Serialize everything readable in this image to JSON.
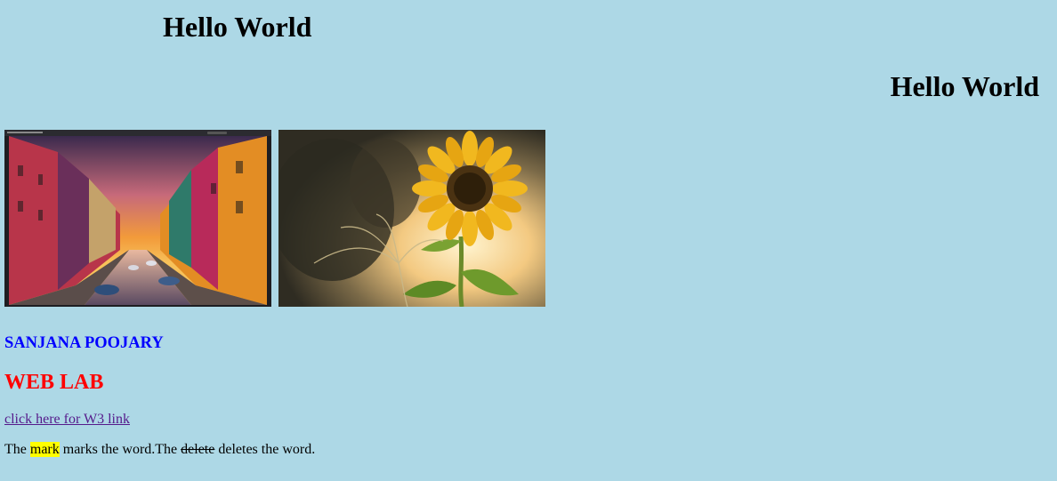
{
  "headings": {
    "center": "Hello World",
    "right": "Hello World"
  },
  "images": {
    "canal": {
      "alt": "Colorful canal houses at sunset",
      "icon": "photo-canal"
    },
    "sunflower": {
      "alt": "Sunflower at sunset",
      "icon": "photo-sunflower"
    }
  },
  "name_heading": "SANJANA POOJARY",
  "lab_heading": "WEB LAB",
  "link": {
    "text": "click here for W3 link"
  },
  "paragraph": {
    "part1": "The ",
    "mark": "mark",
    "part2": " marks the word.The ",
    "del": "delete",
    "part3": " deletes the word."
  },
  "colors": {
    "background": "#add8e6",
    "name_heading": "#0000ff",
    "lab_heading": "#ff0000",
    "link": "#551a8b",
    "mark": "#ffff00"
  }
}
